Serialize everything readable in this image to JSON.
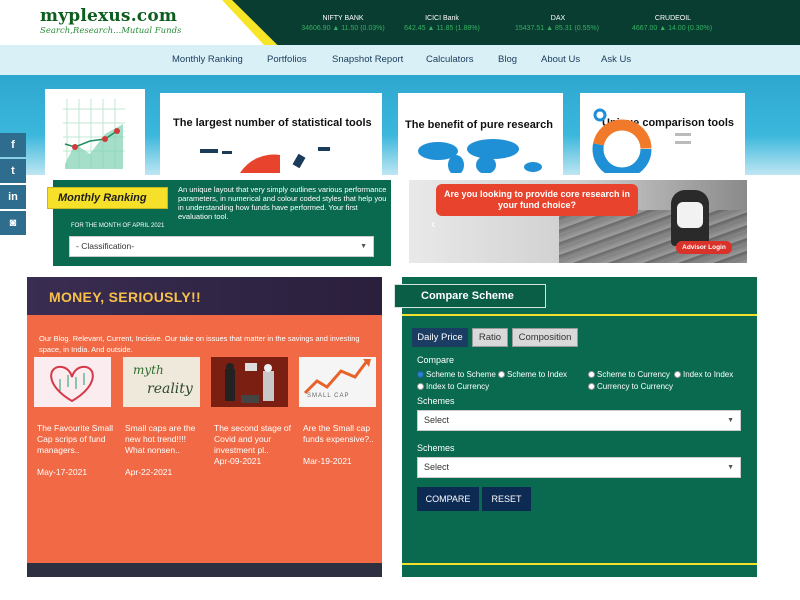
{
  "brand": {
    "name": "myplexus.com",
    "tagline": "Search,Research...Mutual Funds",
    "colors": {
      "dark_green": "#0a3d31",
      "panel_green": "#0a6a4f",
      "yellow": "#f6e02a",
      "orange": "#f16a45",
      "nav_bg": "#d9f0f7"
    }
  },
  "ticker": [
    {
      "label": "NIFTY BANK",
      "value": "34606.90 ▲ 11.50 (0.03%)"
    },
    {
      "label": "ICICI Bank",
      "value": "642.45 ▲ 11.85 (1.88%)"
    },
    {
      "label": "DAX",
      "value": "15437.51 ▲ 85.31 (0.55%)"
    },
    {
      "label": "CRUDEOIL",
      "value": "4667.00 ▲ 14.00 (0.30%)"
    }
  ],
  "nav": [
    "Monthly Ranking",
    "Portfolios",
    "Snapshot Report",
    "Calculators",
    "Blog",
    "About Us",
    "Ask Us"
  ],
  "hero": {
    "card1": "The largest number of statistical tools",
    "card2": "The benefit of pure research",
    "card3": "Unique comparison tools"
  },
  "social": [
    "facebook-icon",
    "twitter-icon",
    "linkedin-icon",
    "money-icon"
  ],
  "social_glyphs": [
    "f",
    "t",
    "in",
    "◙"
  ],
  "monthly_ranking": {
    "badge": "Monthly Ranking",
    "description": "An unique layout that very simply outlines various performance parameters, in numerical and colour coded styles that help you in understanding how funds have performed. Your first evaluation tool.",
    "month": "FOR THE MONTH OF APRIL 2021",
    "select": "- Classification-"
  },
  "banner": {
    "text": "Are you looking to provide core research in your fund choice?",
    "button": "Advisor Login",
    "prev": "‹"
  },
  "blog": {
    "title": "MONEY, SERIOUSLY!!",
    "description": "Our Blog. Relevant, Current, Incisive. Our take on issues that matter in the savings and investing space, in India. And outside.",
    "posts": [
      {
        "title": "The Favourite Small Cap scrips of fund managers..",
        "date": "May-17-2021"
      },
      {
        "title": "Small caps are the new hot trend!!!! What nonsen..",
        "date": "Apr-22-2021"
      },
      {
        "title": "The second stage of Covid and your investment pl..",
        "date": "Apr-09-2021"
      },
      {
        "title": "Are the Small cap funds expensive?..",
        "date": "Mar-19-2021"
      }
    ],
    "thumb_texts": {
      "myth": "myth",
      "reality": "reality",
      "smallcap": "SMALL CAP"
    }
  },
  "compare": {
    "title": "Compare Scheme",
    "tabs": [
      "Daily Price",
      "Ratio",
      "Composition"
    ],
    "compare_label": "Compare",
    "radios": [
      "Scheme to Scheme",
      "Scheme to Index",
      "Scheme to Currency",
      "Index to Index",
      "Index to Currency",
      "Currency to Currency"
    ],
    "selected_radio": "Scheme to Scheme",
    "schemes_label": "Schemes",
    "select_placeholder": "Select",
    "buttons": [
      "COMPARE",
      "RESET"
    ]
  }
}
